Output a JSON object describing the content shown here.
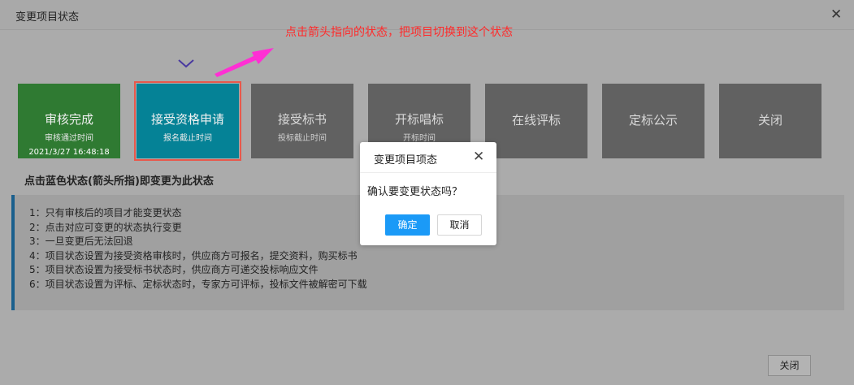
{
  "dialog": {
    "title": "变更项目状态",
    "close_symbol": "✕",
    "instruction_hint": "点击箭头指向的状态，把项目切换到这个状态",
    "section_title": "点击蓝色状态(箭头所指)即变更为此状态",
    "footer_close_label": "关闭"
  },
  "statuses": [
    {
      "title": "审核完成",
      "subtitle": "审核通过时间",
      "time": "2021/3/27 16:48:18",
      "state": "completed"
    },
    {
      "title": "接受资格申请",
      "subtitle": "报名截止时间",
      "state": "current"
    },
    {
      "title": "接受标书",
      "subtitle": "投标截止时间",
      "state": "pending"
    },
    {
      "title": "开标唱标",
      "subtitle": "开标时间",
      "state": "pending"
    },
    {
      "title": "在线评标",
      "state": "pending"
    },
    {
      "title": "定标公示",
      "state": "pending"
    },
    {
      "title": "关闭",
      "state": "pending"
    }
  ],
  "notes": [
    "1：只有审核后的项目才能变更状态",
    "2：点击对应可变更的状态执行变更",
    "3：一旦变更后无法回退",
    "4：项目状态设置为接受资格审核时，供应商方可报名，提交资料，购买标书",
    "5：项目状态设置为接受标书状态时，供应商方可递交投标响应文件",
    "6：项目状态设置为评标、定标状态时，专家方可评标，投标文件被解密可下载"
  ],
  "confirm_modal": {
    "title": "变更项目项态",
    "close_symbol": "✕",
    "message": "确认要变更状态吗？",
    "confirm_label": "确定",
    "cancel_label": "取消"
  },
  "colors": {
    "completed": "#2f7a32",
    "current": "#058296",
    "pending": "#616161",
    "highlight_border": "#e8584b",
    "hint_text": "#ff2a2a",
    "arrow": "#ff2fd4",
    "primary_button": "#1b9af7"
  },
  "icons": {
    "pointer_arrow": "arrow-icon",
    "selected_marker": "chevron-down-icon"
  }
}
